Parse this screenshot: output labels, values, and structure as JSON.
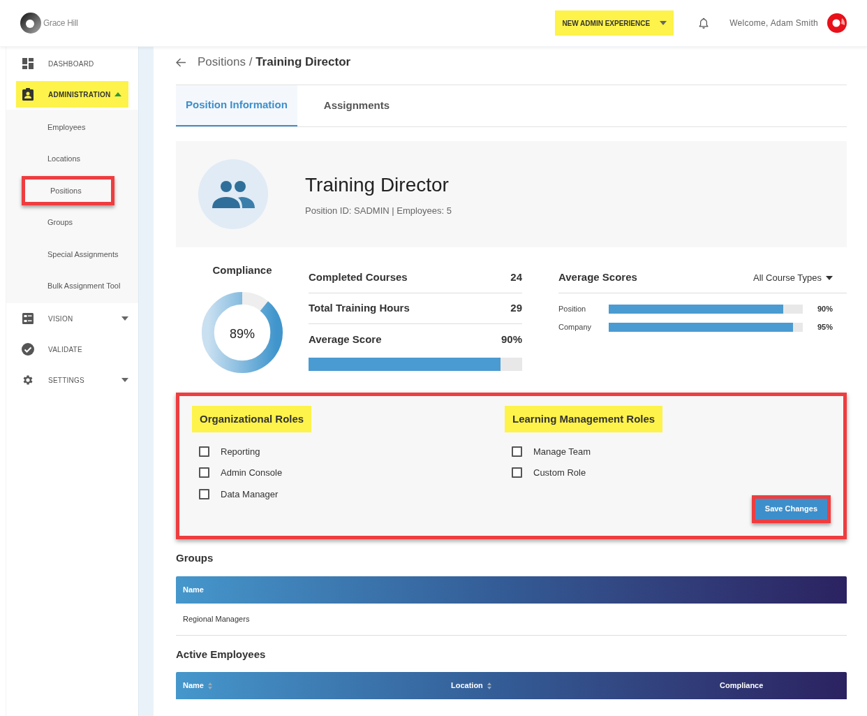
{
  "header": {
    "logo_text": "Grace Hill",
    "admin_button": {
      "label": "NEW ADMIN EXPERIENCE",
      "highlighted": true
    },
    "welcome": "Welcome, Adam Smith"
  },
  "sidebar": {
    "items": [
      {
        "label": "DASHBOARD",
        "highlighted": false
      },
      {
        "label": "ADMINISTRATION",
        "expanded": true,
        "highlighted": true,
        "children": [
          {
            "label": "Employees",
            "outlined": false
          },
          {
            "label": "Locations",
            "outlined": false
          },
          {
            "label": "Positions",
            "outlined": true
          },
          {
            "label": "Groups",
            "outlined": false
          },
          {
            "label": "Special Assignments",
            "outlined": false
          },
          {
            "label": "Bulk Assignment Tool",
            "outlined": false
          }
        ]
      },
      {
        "label": "VISION",
        "expanded": false,
        "highlighted": false
      },
      {
        "label": "VALIDATE",
        "highlighted": false
      },
      {
        "label": "SETTINGS",
        "expanded": false,
        "highlighted": false
      }
    ]
  },
  "breadcrumb": {
    "parent": "Positions",
    "separator": "/",
    "current": "Training Director"
  },
  "tabs": [
    {
      "label": "Position Information",
      "selected": true
    },
    {
      "label": "Assignments",
      "selected": false
    }
  ],
  "position": {
    "title": "Training Director",
    "subtitle": "Position ID: SADMIN | Employees: 5"
  },
  "compliance": {
    "title": "Compliance",
    "reading": "89%",
    "level": 0.89
  },
  "stats": [
    {
      "label": "Completed Courses",
      "value": "24"
    },
    {
      "label": "Total Training Hours",
      "value": "29"
    },
    {
      "label": "Average Score",
      "value": "90%"
    }
  ],
  "average_score_bar": {
    "level": 0.9
  },
  "average_scores": {
    "title": "Average Scores",
    "filter": "All Course Types",
    "rows": [
      {
        "label": "Position",
        "level": 0.9,
        "reading": "90%"
      },
      {
        "label": "Company",
        "level": 0.95,
        "reading": "95%"
      }
    ]
  },
  "roles": {
    "outlined": true,
    "columns": [
      {
        "title": "Organizational Roles",
        "highlighted": true,
        "items": [
          {
            "label": "Reporting",
            "checked": false
          },
          {
            "label": "Admin Console",
            "checked": false
          },
          {
            "label": "Data Manager",
            "checked": false
          }
        ]
      },
      {
        "title": "Learning Management Roles",
        "highlighted": true,
        "items": [
          {
            "label": "Manage Team",
            "checked": false
          },
          {
            "label": "Custom Role",
            "checked": false
          }
        ]
      }
    ],
    "save_button": {
      "label": "Save Changes",
      "outlined": true
    }
  },
  "groups": {
    "title": "Groups",
    "columns": [
      {
        "label": "Name",
        "sortable": false
      }
    ],
    "rows": [
      [
        "Regional Managers"
      ]
    ]
  },
  "active_employees": {
    "title": "Active Employees",
    "columns": [
      {
        "label": "Name",
        "sortable": true
      },
      {
        "label": "Location",
        "sortable": true
      },
      {
        "label": "Compliance",
        "sortable": false
      }
    ]
  }
}
